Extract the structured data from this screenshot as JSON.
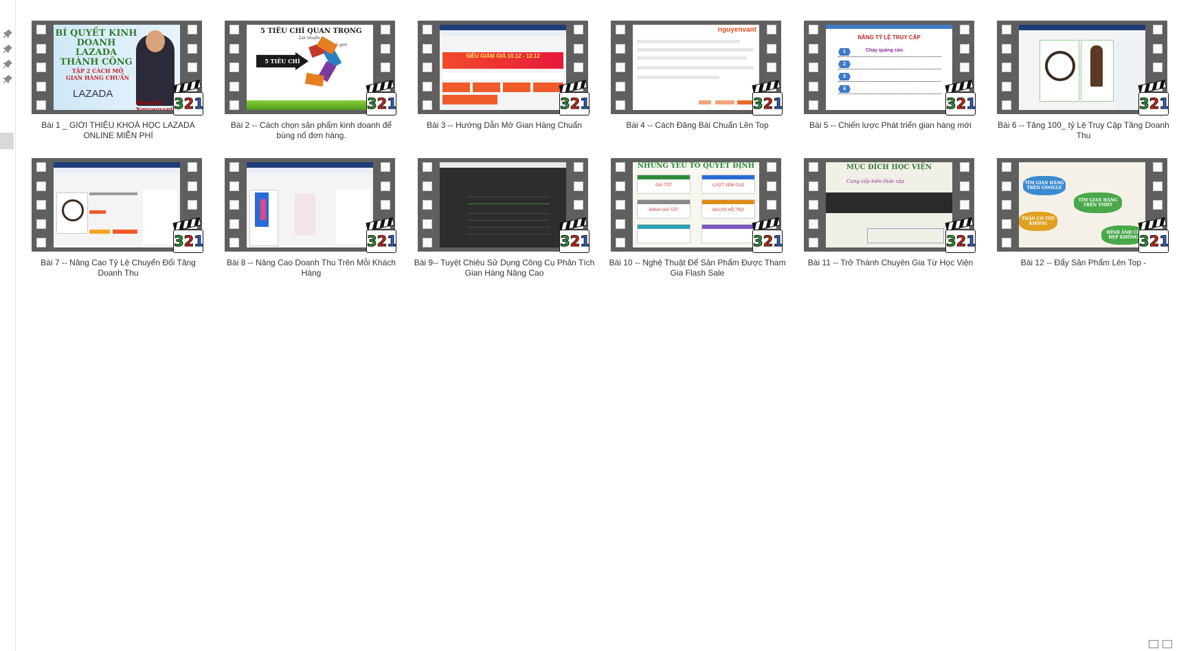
{
  "colors": {
    "film": "#5f5f5f",
    "caption": "#333333",
    "selection": "#d9d9d9"
  },
  "nav_icons": [
    "pin-icon",
    "pin-icon",
    "pin-icon",
    "pin-icon"
  ],
  "files": [
    {
      "name": "Bài 1 _ GIỚI THIỆU KHOÁ HỌC LAZADA ONLINE MIỄN PHÍ",
      "thumb": {
        "h": "BÍ QUYẾT KINH DOANH LAZADA THÀNH CÔNG",
        "sub": "TẬP 2 CÁCH MỞ GIAN HÀNG CHUẨN",
        "logo": "LAZADA",
        "cap": "Share by Nguyenvantin.vn"
      }
    },
    {
      "name": "Bài 2  -- Cách chọn sản phẩm kinh doanh để bùng nổ đơn hàng.",
      "thumb": {
        "ttl": "5 TIÊU CHÍ QUAN TRỌNG",
        "arrow": "5 TIÊU CHÍ",
        "a": "Lợi nhuận",
        "b": "Nhỏ gọn"
      }
    },
    {
      "name": "Bài 3 -- Hướng Dẫn Mở Gian Hàng Chuẩn",
      "thumb": {
        "banner": "SIÊU GIẢM GIÁ 10.12 - 12.12"
      }
    },
    {
      "name": "Bài 4 -- Cách Đăng Bài Chuẩn Lên Top",
      "thumb": {
        "brand": "nguyenvant"
      }
    },
    {
      "name": "Bài 5 -- Chiến lược Phát triển gian hàng mới",
      "thumb": {
        "title": "NÂNG TỶ LỆ TRUY CẬP",
        "step1": "Chạy quảng cáo"
      }
    },
    {
      "name": "Bài 6 -- Tăng 100_ tỷ Lệ Truy Cập Tăng Doanh Thu",
      "thumb": {}
    },
    {
      "name": "Bài 7 -- Nâng Cao Tỷ Lệ Chuyển Đổi Tăng Doanh Thu",
      "thumb": {}
    },
    {
      "name": "Bài 8 -- Nâng Cao Doanh Thu Trên Mỗi Khách Hàng",
      "thumb": {}
    },
    {
      "name": "Bài 9-- Tuyệt Chiêu Sử Dụng Công Cụ Phân Tích Gian Hàng Nâng Cao",
      "thumb": {}
    },
    {
      "name": "Bài 10 -- Nghệ Thuật Để Sản Phẩm Được Tham Gia Flash Sale",
      "thumb": {
        "hd": "NHỮNG YẾU TỐ QUYẾT ĐỊNH",
        "c1": "GIÁ TỐT",
        "c2": "LƯỢT XEM CAO",
        "c3": "ĐÁNH GIÁ TỐT",
        "c4": "NGƯỜI HỖ TRỢ"
      }
    },
    {
      "name": "Bài 11 -- Trở Thành Chuyên Gia Từ Học Viện",
      "thumb": {
        "hd": "MỤC ĐÍCH HỌC VIỆN",
        "sub": "Cung cấp kiến thức cập"
      }
    },
    {
      "name": "Bài 12 --  Đẩy Sản Phẩm Lên Top -",
      "thumb": {
        "c1": "TÌM GIAN HÀNG TRÊN GOOGLE",
        "c2": "TÌM GIAN HÀNG TRÊN TMĐT",
        "c3": "THẢO CÓ TỚT KHÔNG",
        "c4": "HÌNH ẢNH CÓ ĐẸP KHÔNG"
      }
    }
  ],
  "badge": {
    "d1": "3",
    "d2": "2",
    "d3": "1"
  }
}
